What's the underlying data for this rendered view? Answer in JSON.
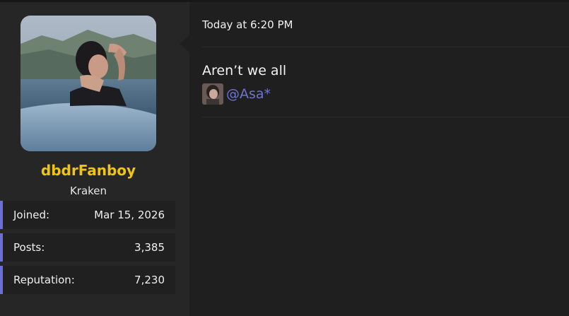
{
  "user": {
    "name": "dbdrFanboy",
    "title": "Kraken",
    "avatar_icon": "user-avatar-photo",
    "name_color": "#f1c40f"
  },
  "stats": [
    {
      "label": "Joined:",
      "value": "Mar 15, 2026"
    },
    {
      "label": "Posts:",
      "value": "3,385"
    },
    {
      "label": "Reputation:",
      "value": "7,230"
    }
  ],
  "message": {
    "timestamp": "Today at 6:20 PM",
    "text": "Aren’t we all",
    "mention": "@Asa*",
    "mention_color": "#6d74d6"
  },
  "colors": {
    "accent_bar": "#6a6fd6",
    "background": "#1f1f1f",
    "panel": "#262626"
  }
}
